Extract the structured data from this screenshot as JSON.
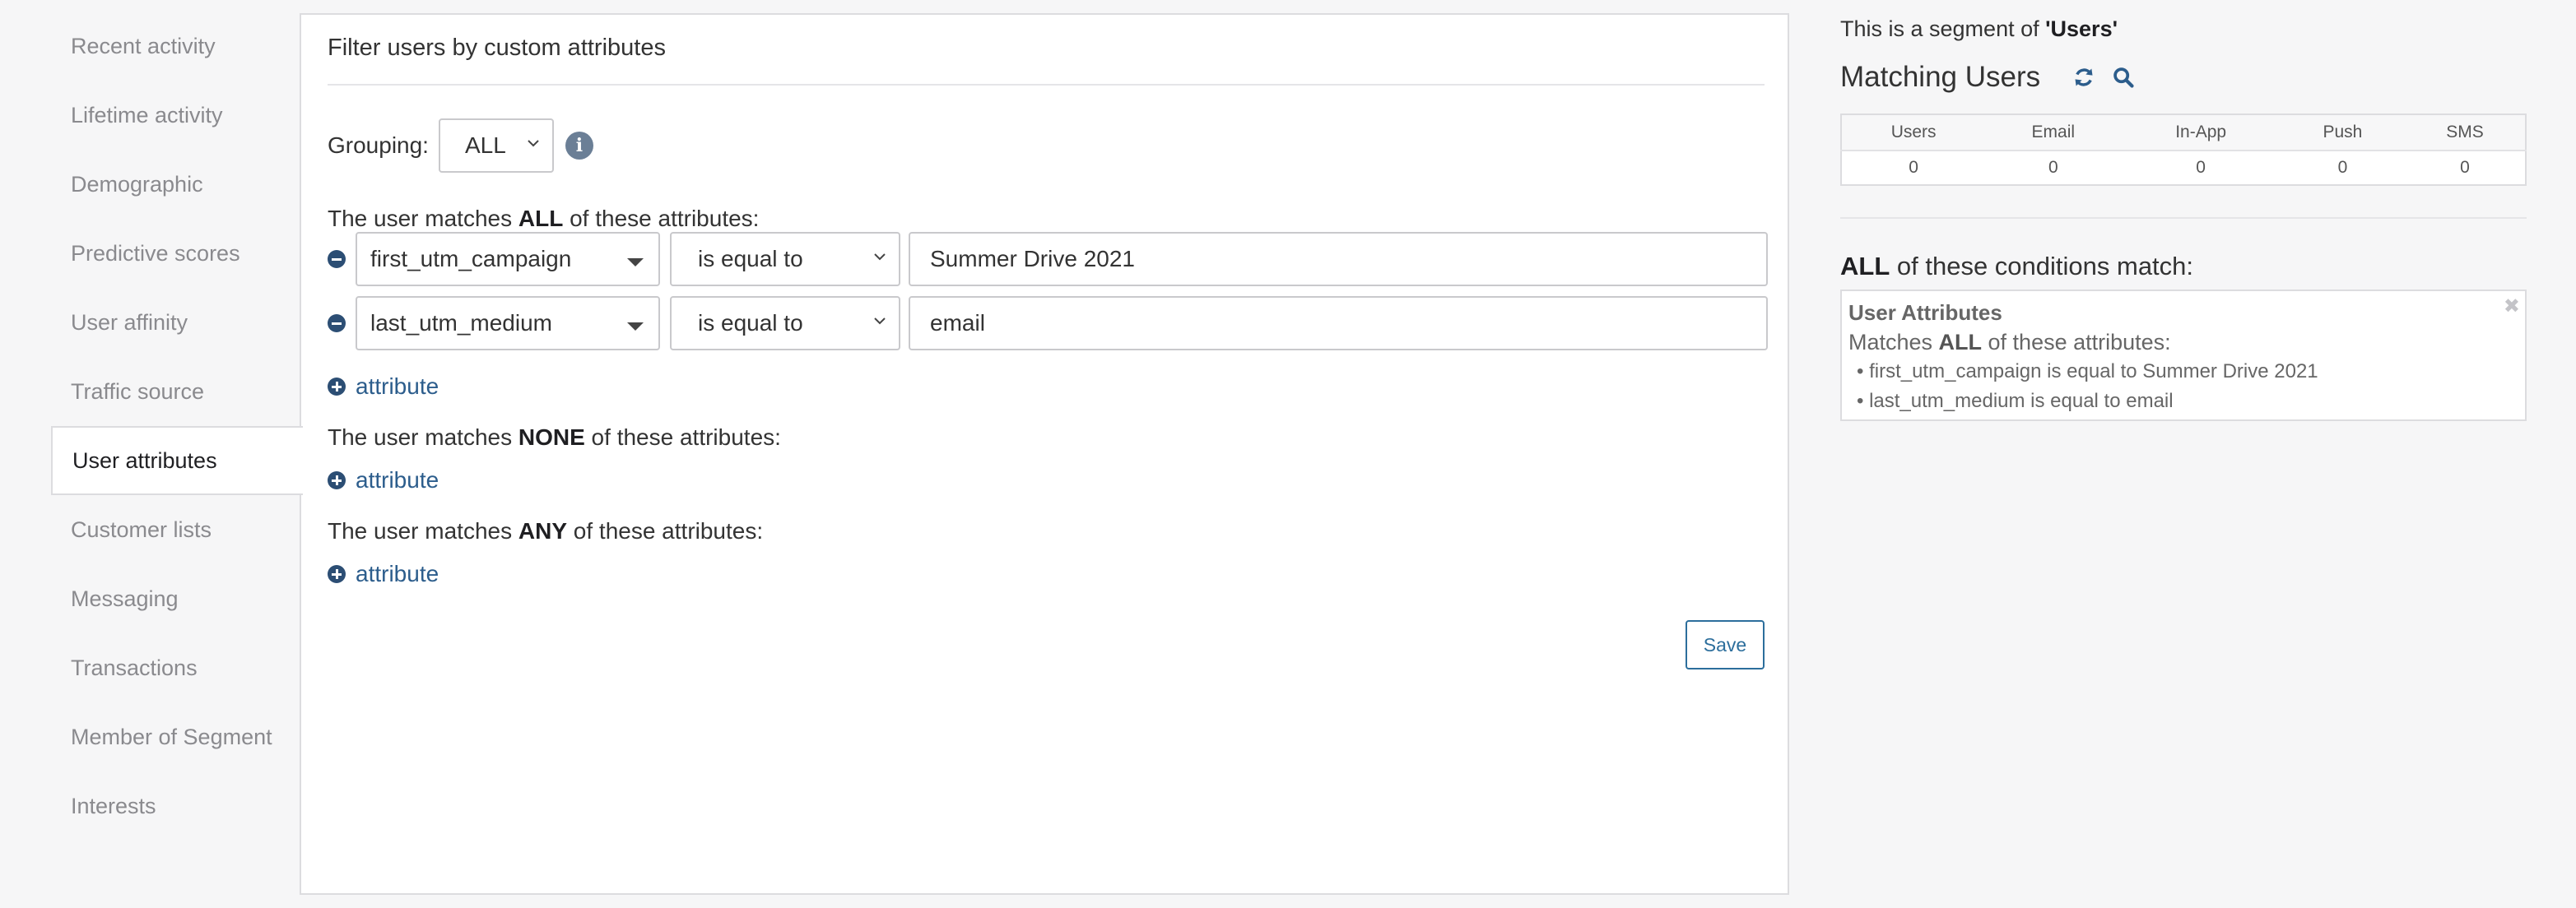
{
  "sidebar": {
    "items": [
      {
        "label": "Recent activity"
      },
      {
        "label": "Lifetime activity"
      },
      {
        "label": "Demographic"
      },
      {
        "label": "Predictive scores"
      },
      {
        "label": "User affinity"
      },
      {
        "label": "Traffic source"
      },
      {
        "label": "User attributes",
        "active": true
      },
      {
        "label": "Customer lists"
      },
      {
        "label": "Messaging"
      },
      {
        "label": "Transactions"
      },
      {
        "label": "Member of Segment"
      },
      {
        "label": "Interests"
      }
    ]
  },
  "filter": {
    "title": "Filter users by custom attributes",
    "grouping_label": "Grouping:",
    "grouping_value": "ALL",
    "all_section": {
      "prefix": "The user matches ",
      "keyword": "ALL",
      "suffix": " of these attributes:"
    },
    "conditions": [
      {
        "field": "first_utm_campaign",
        "operator": "is equal to",
        "value": "Summer Drive 2021"
      },
      {
        "field": "last_utm_medium",
        "operator": "is equal to",
        "value": "email"
      }
    ],
    "none_section": {
      "prefix": "The user matches ",
      "keyword": "NONE",
      "suffix": " of these attributes:"
    },
    "any_section": {
      "prefix": "The user matches ",
      "keyword": "ANY",
      "suffix": " of these attributes:"
    },
    "add_attribute_label": "attribute",
    "save_label": "Save"
  },
  "summary": {
    "segment_prefix": "This is a segment of ",
    "segment_name": "'Users'",
    "matching_title": "Matching Users",
    "table": {
      "headers": [
        "Users",
        "Email",
        "In-App",
        "Push",
        "SMS"
      ],
      "values": [
        "0",
        "0",
        "0",
        "0",
        "0"
      ]
    },
    "conditions_keyword": "ALL",
    "conditions_suffix": " of these conditions match:",
    "box_title": "User Attributes",
    "box_sub_prefix": "Matches ",
    "box_sub_keyword": "ALL",
    "box_sub_suffix": " of these attributes:",
    "box_items": [
      "first_utm_campaign is equal to Summer Drive 2021",
      "last_utm_medium is equal to email"
    ],
    "close_symbol": "✖"
  },
  "colors": {
    "accent": "#2c5d8c",
    "icon_dark": "#2c4e74",
    "info_icon": "#6b7f96",
    "sidebar_text": "#8a8a8e"
  },
  "icons": {
    "refresh": "refresh-icon",
    "search": "search-icon",
    "info": "info-icon",
    "remove": "minus-circle-icon",
    "add": "plus-circle-icon",
    "close": "close-icon"
  }
}
